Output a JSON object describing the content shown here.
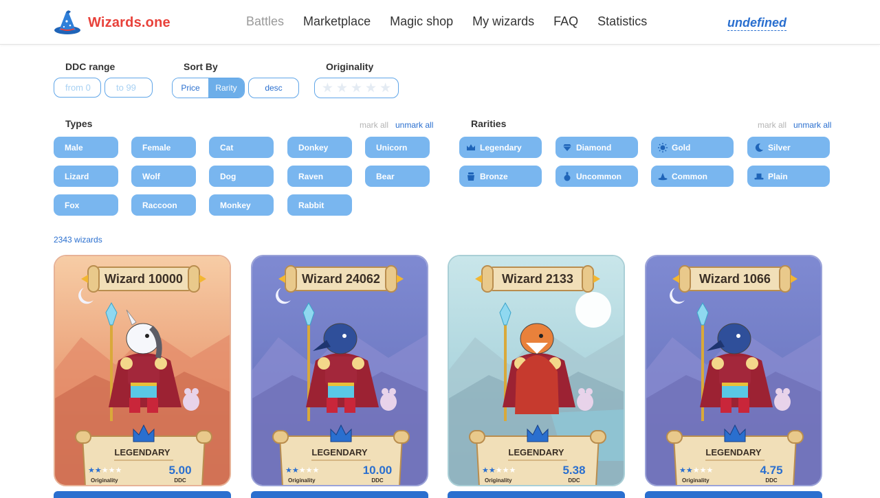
{
  "header": {
    "logo_text": "Wizards.one",
    "nav": [
      "Battles",
      "Marketplace",
      "Magic shop",
      "My wizards",
      "FAQ",
      "Statistics"
    ],
    "active_nav": "Battles",
    "user": "undefined"
  },
  "filters": {
    "ddc_label": "DDC range",
    "from_placeholder": "from 0",
    "to_placeholder": "to 99",
    "sort_label": "Sort By",
    "sort_options": [
      "Price",
      "Rarity"
    ],
    "sort_selected": "Rarity",
    "order": "desc",
    "originality_label": "Originality",
    "originality_stars": 5
  },
  "types": {
    "label": "Types",
    "mark_all": "mark all",
    "unmark_all": "unmark all",
    "items": [
      "Male",
      "Female",
      "Cat",
      "Donkey",
      "Unicorn",
      "Lizard",
      "Wolf",
      "Dog",
      "Raven",
      "Bear",
      "Fox",
      "Raccoon",
      "Monkey",
      "Rabbit"
    ]
  },
  "rarities": {
    "label": "Rarities",
    "mark_all": "mark all",
    "unmark_all": "unmark all",
    "items": [
      {
        "label": "Legendary",
        "icon": "crown-icon"
      },
      {
        "label": "Diamond",
        "icon": "diamond-icon"
      },
      {
        "label": "Gold",
        "icon": "sun-icon"
      },
      {
        "label": "Silver",
        "icon": "moon-icon"
      },
      {
        "label": "Bronze",
        "icon": "pot-icon"
      },
      {
        "label": "Uncommon",
        "icon": "potion-icon"
      },
      {
        "label": "Common",
        "icon": "wizard-hat-icon"
      },
      {
        "label": "Plain",
        "icon": "top-hat-icon"
      }
    ]
  },
  "count_text": "2343 wizards",
  "cards": [
    {
      "name": "Wizard 10000",
      "rarity": "LEGENDARY",
      "price": "5.00",
      "stars": 2,
      "orig_label": "Originality",
      "ddc_label": "DDC",
      "theme": "sunset",
      "animal": "unicorn"
    },
    {
      "name": "Wizard 24062",
      "rarity": "LEGENDARY",
      "price": "10.00",
      "stars": 2,
      "orig_label": "Originality",
      "ddc_label": "DDC",
      "theme": "night",
      "animal": "raven"
    },
    {
      "name": "Wizard 2133",
      "rarity": "LEGENDARY",
      "price": "5.38",
      "stars": 2,
      "orig_label": "Originality",
      "ddc_label": "DDC",
      "theme": "day",
      "animal": "fox"
    },
    {
      "name": "Wizard 1066",
      "rarity": "LEGENDARY",
      "price": "4.75",
      "stars": 2,
      "orig_label": "Originality",
      "ddc_label": "DDC",
      "theme": "night",
      "animal": "raven"
    }
  ],
  "colors": {
    "brand_red": "#e8413a",
    "accent_blue": "#2a6fcf",
    "chip_blue": "#79b6ef"
  }
}
